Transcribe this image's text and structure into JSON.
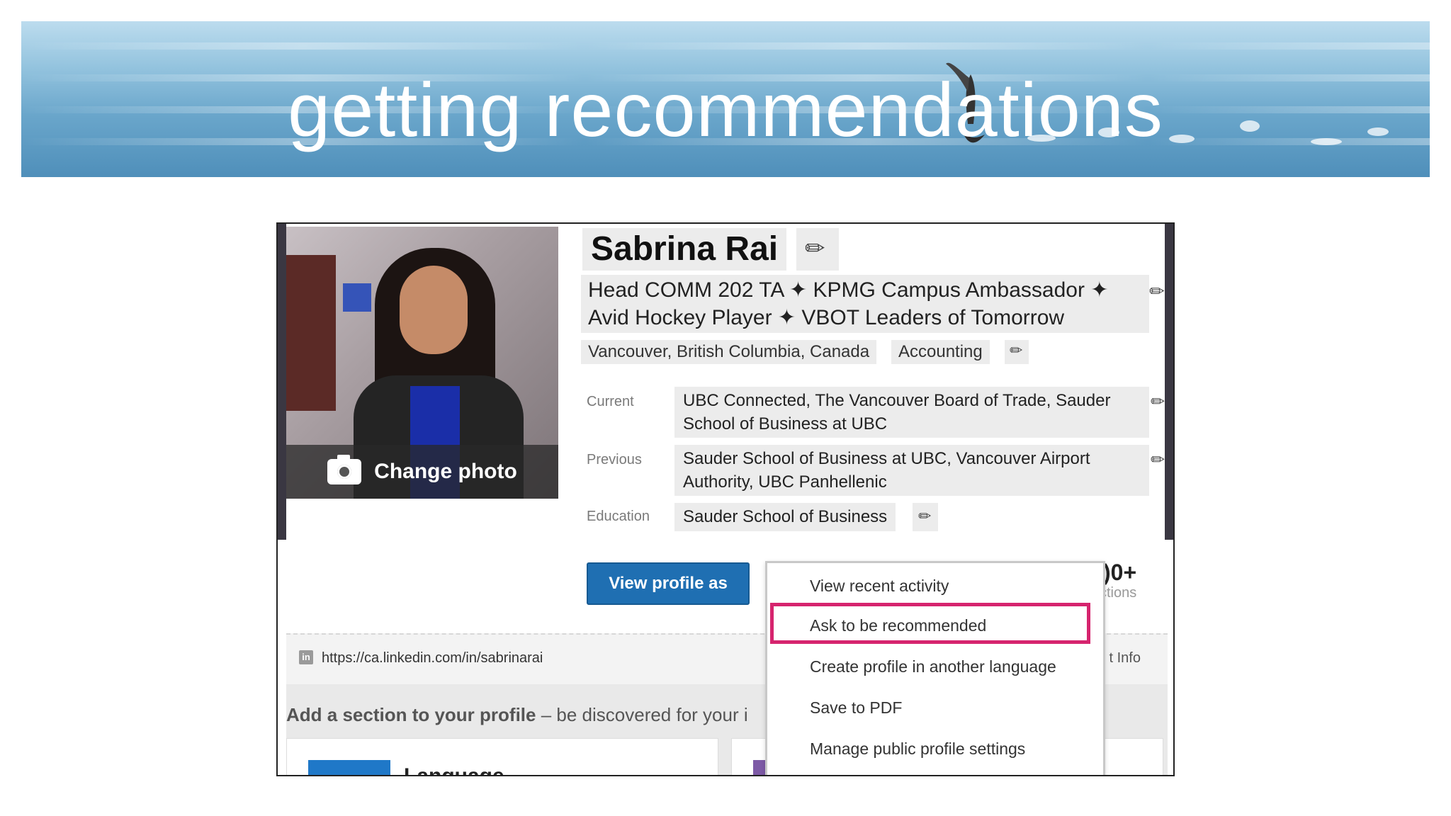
{
  "slide": {
    "title": "getting recommendations"
  },
  "profile": {
    "name": "Sabrina Rai",
    "headline_line1": "Head COMM 202 TA ✦ KPMG Campus Ambassador ✦",
    "headline_line2": "Avid Hockey Player ✦ VBOT Leaders of Tomorrow",
    "location": "Vancouver, British Columbia, Canada",
    "industry": "Accounting",
    "change_photo": "Change photo",
    "current_label": "Current",
    "current_line1": "UBC Connected, The Vancouver Board of Trade, Sauder",
    "current_line2": "School of Business at UBC",
    "previous_label": "Previous",
    "previous_line1": "Sauder School of Business at UBC, Vancouver Airport",
    "previous_line2": "Authority, UBC Panhellenic",
    "education_label": "Education",
    "education_value": "Sauder School of Business",
    "view_profile_as": "View profile as",
    "connections_count": ")0+",
    "connections_label": "ctions",
    "url": "https://ca.linkedin.com/in/sabrinarai",
    "contact_info": "t Info",
    "in_icon_text": "in",
    "add_section_bold": "Add a section to your profile",
    "add_section_rest": " – be discovered for your i",
    "card_language": "Language"
  },
  "dropdown": {
    "items": [
      "View recent activity",
      "Ask to be recommended",
      "Create profile in another language",
      "Save to PDF",
      "Manage public profile settings"
    ],
    "highlighted_index": 1,
    "highlight_color": "#d6246e"
  },
  "colors": {
    "button_blue": "#1f6fb2",
    "highlight": "#d6246e"
  },
  "icons": [
    "pencil-icon",
    "camera-icon",
    "linkedin-icon"
  ]
}
